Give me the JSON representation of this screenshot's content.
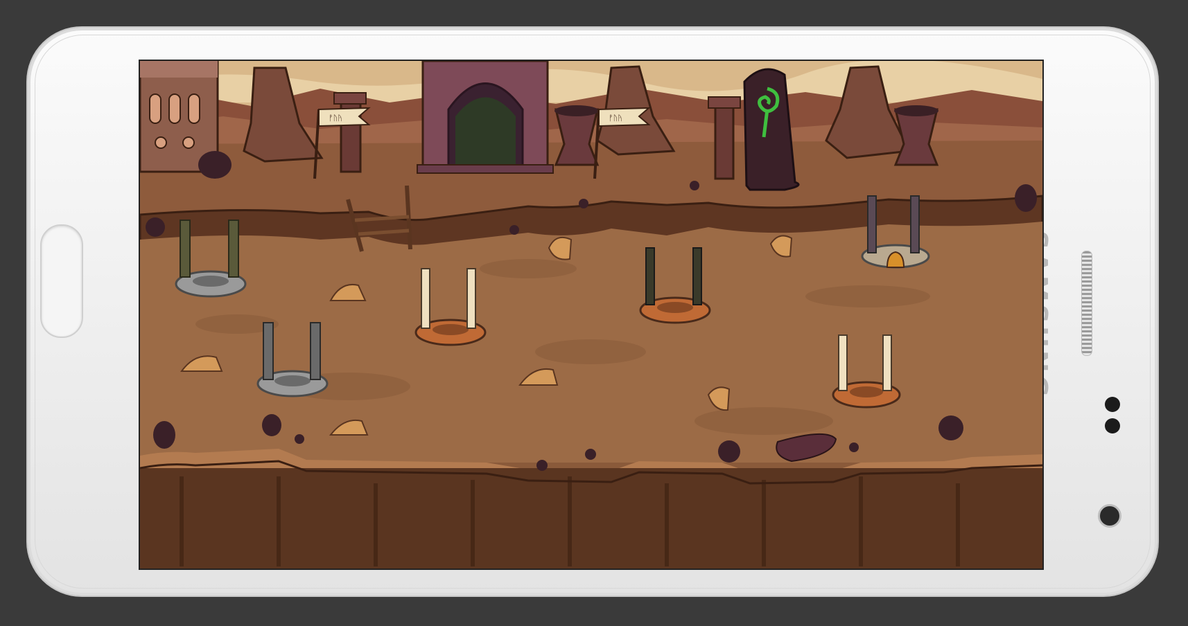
{
  "device": {
    "brand_text": "SAMSUNG",
    "colors": {
      "body": "#f2f2f2",
      "bezel_text": "#b9b9b9"
    }
  },
  "game": {
    "scene": "desert-canyon-level",
    "flags": [
      {
        "text": "ᚡᚢᚤ"
      },
      {
        "text": "ᚡᚢᚤ"
      }
    ],
    "tower_slots": [
      {
        "id": "slot-1",
        "type": "stone-empty"
      },
      {
        "id": "slot-2",
        "type": "stone-empty"
      },
      {
        "id": "slot-3",
        "type": "orange-spiked"
      },
      {
        "id": "slot-4",
        "type": "orange-plain"
      },
      {
        "id": "slot-5",
        "type": "stone-bell"
      },
      {
        "id": "slot-6",
        "type": "orange-plain"
      }
    ],
    "colors": {
      "ground": "#9a6a45",
      "sky": "#d8b98a",
      "cliff": "#6a3f26",
      "portal_glow": "#3fbf3f"
    }
  }
}
